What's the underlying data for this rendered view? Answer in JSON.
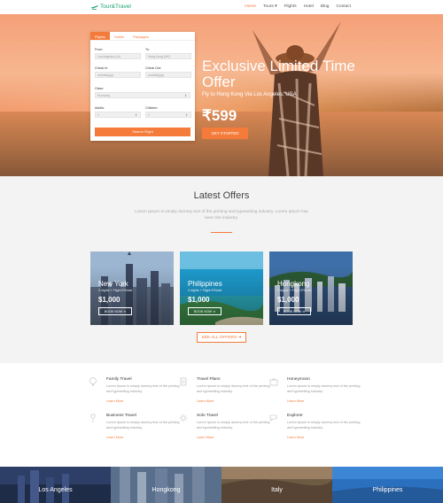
{
  "nav": {
    "logo": "Tour&Travel",
    "menu": [
      {
        "label": "Home",
        "active": true
      },
      {
        "label": "Tours"
      },
      {
        "label": "Flights"
      },
      {
        "label": "Hotel"
      },
      {
        "label": "Blog"
      },
      {
        "label": "Contact"
      }
    ]
  },
  "booking": {
    "tabs": [
      "Flights",
      "Hotels",
      "Packages"
    ],
    "from_label": "From:",
    "from_value": "Los Angeles (LA)",
    "to_label": "To:",
    "to_value": "Hong Kong (HK)",
    "checkin_label": "Check In:",
    "checkin_value": "mm/dd/yyyy",
    "checkout_label": "Check Out:",
    "checkout_value": "mm/dd/yyyy",
    "class_label": "Class:",
    "class_value": "Economy",
    "adults_label": "Adults:",
    "adults_value": "1",
    "children_label": "Children:",
    "children_value": "1",
    "search_button": "Search Flight"
  },
  "hero": {
    "title": "Exclusive Limited Time Offer",
    "subtitle": "Fly to Hong Kong Via Los Angeles, USA",
    "price": "₹599",
    "button": "GET STARTED"
  },
  "offers": {
    "title": "Latest Offers",
    "description": "Lorem Ipsum is simply dummy text of the printing and typesetting industry. Lorem Ipsum has been the industry.",
    "cards": [
      {
        "city": "New York",
        "meta": "2 nights + Flight 5*Hotel",
        "price": "$1,000",
        "button": "BOOK NOW ➜"
      },
      {
        "city": "Philippines",
        "meta": "4 nights + Flight 5*Hotel",
        "price": "$1,000",
        "button": "BOOK NOW ➜"
      },
      {
        "city": "Hongkong",
        "meta": "2 nights + Flight 5*Hotel",
        "price": "$1,000",
        "button": "BOOK NOW ➜"
      }
    ],
    "see_all": "SEE ALL OFFERS ➜"
  },
  "features": [
    {
      "icon": "balloon-icon",
      "title": "Family Travel",
      "desc": "Lorem Ipsum is simply dummy text of the printing and typesetting industry.",
      "link": "Learn More"
    },
    {
      "icon": "document-icon",
      "title": "Travel Plans",
      "desc": "Lorem Ipsum is simply dummy text of the printing and typesetting industry.",
      "link": "Learn More"
    },
    {
      "icon": "suitcase-icon",
      "title": "Honeymoon",
      "desc": "Lorem Ipsum is simply dummy text of the printing and typesetting industry.",
      "link": "Learn More"
    },
    {
      "icon": "trophy-icon",
      "title": "Business Travel",
      "desc": "Lorem Ipsum is simply dummy text of the printing and typesetting industry.",
      "link": "Learn More"
    },
    {
      "icon": "sun-icon",
      "title": "Solo Travel",
      "desc": "Lorem Ipsum is simply dummy text of the printing and typesetting industry.",
      "link": "Learn More"
    },
    {
      "icon": "chat-icon",
      "title": "Explorer",
      "desc": "Lorem Ipsum is simply dummy text of the printing and typesetting industry.",
      "link": "Learn More"
    }
  ],
  "destinations": [
    "Los Angeles",
    "Hongkong",
    "Italy",
    "Philippines"
  ],
  "colors": {
    "accent": "#f47b3a",
    "brand": "#1aa36f"
  }
}
